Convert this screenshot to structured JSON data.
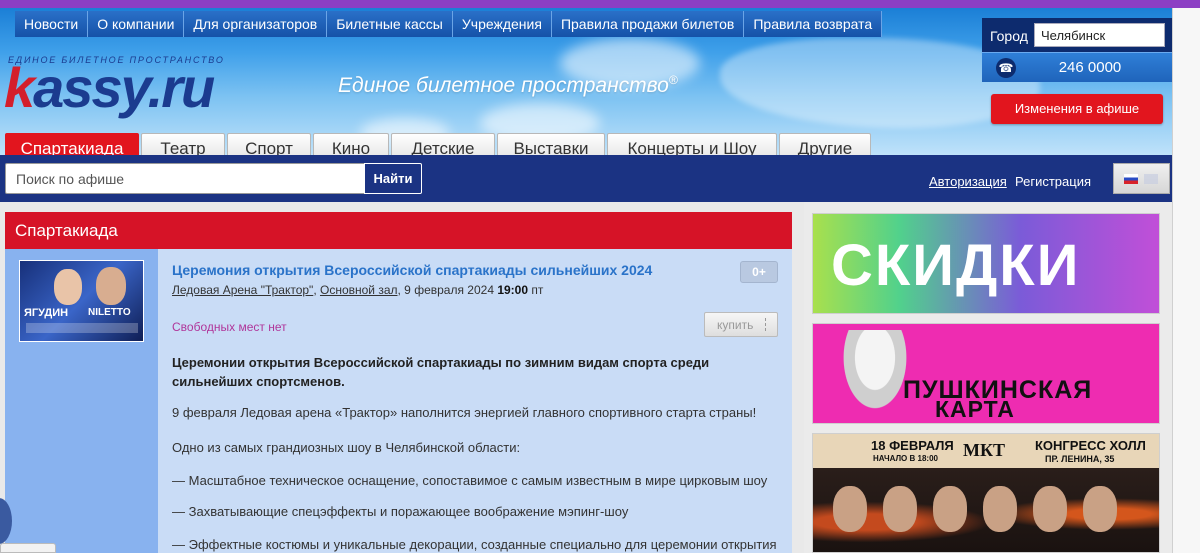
{
  "top_nav": [
    "Новости",
    "О компании",
    "Для организаторов",
    "Билетные кассы",
    "Учреждения",
    "Правила продажи билетов",
    "Правила возврата"
  ],
  "logo": {
    "tagline": "ЕДИНОЕ БИЛЕТНОЕ ПРОСТРАНСТВО",
    "letter": "k",
    "rest": "assy.ru"
  },
  "slogan": "Единое билетное пространство",
  "slogan_mark": "®",
  "city": {
    "label": "Город",
    "value": "Челябинск"
  },
  "phone": {
    "icon": "phone-icon",
    "number": "246 0000"
  },
  "changes_button": "Изменения в афише",
  "categories": [
    "Спартакиада",
    "Театр",
    "Спорт",
    "Кино",
    "Детские",
    "Выставки",
    "Концерты и Шоу",
    "Другие"
  ],
  "search": {
    "placeholder": "Поиск по афише",
    "button": "Найти"
  },
  "auth": {
    "login": "Авторизация",
    "register": "Регистрация"
  },
  "section_title": "Спартакиада",
  "poster": {
    "name1": "ЯГУДИН",
    "name2": "NILETTO"
  },
  "event": {
    "title": "Церемония открытия Всероссийской спартакиады сильнейших 2024",
    "age": "0+",
    "venue": "Ледовая Арена \"Трактор\"",
    "hall": "Основной зал",
    "date": ", 9 февраля 2024 ",
    "time": "19:00",
    "weekday": " пт",
    "availability": "Свободных мест нет",
    "buy_button": "купить",
    "lead": "Церемонии открытия Всероссийской спартакиады по зимним видам спорта среди сильнейших спортсменов.",
    "paragraphs": [
      "9 февраля Ледовая арена «Трактор» наполнится энергией главного спортивного старта страны!",
      "Одно из самых грандиозных шоу в Челябинской области:",
      "— Масштабное техническое оснащение, сопоставимое с самым известным в мире цирковым шоу",
      "— Захватывающие спецэффекты и поражающее воображение мэпинг-шоу",
      "— Эффектные костюмы и уникальные декорации, созданные специально для церемонии открытия"
    ]
  },
  "banners": {
    "discounts": "СКИДКИ",
    "pushkin_line1": "ПУШКИНСКАЯ",
    "pushkin_line2": "КАРТА",
    "concert_date": "18 ФЕВРАЛЯ",
    "concert_time": "НАЧАЛО В 18:00",
    "concert_org": "МКТ",
    "concert_venue": "КОНГРЕСС ХОЛЛ",
    "concert_address": "ПР. ЛЕНИНА, 35"
  }
}
